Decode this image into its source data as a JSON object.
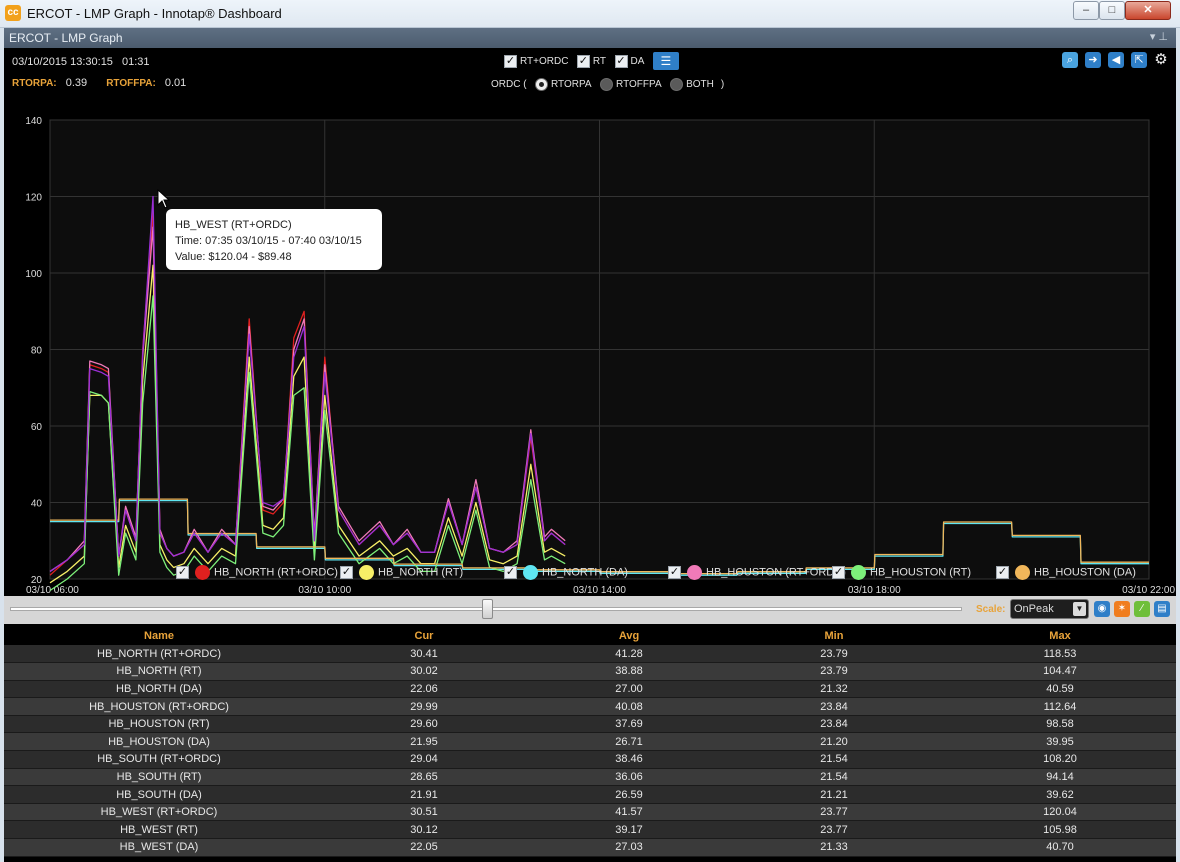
{
  "window": {
    "title": "ERCOT - LMP Graph - Innotap® Dashboard",
    "icon_glyph": "cc",
    "minimize_glyph": "–",
    "maximize_glyph": "□",
    "close_glyph": "✕"
  },
  "panel": {
    "title": "ERCOT - LMP Graph",
    "pin_glyphs": "▾ ⊥"
  },
  "info": {
    "timestamp": "03/10/2015 13:30:15",
    "counter": "01:31",
    "rtorpa_label": "RTORPA:",
    "rtorpa_value": "0.39",
    "rtoffpa_label": "RTOFFPA:",
    "rtoffpa_value": "0.01"
  },
  "controls": {
    "checkbox_glyph": "✓",
    "toggles": [
      "RT+ORDC",
      "RT",
      "DA"
    ],
    "list_icon": "list-icon",
    "ordc_label": "ORDC (",
    "ordc_close": ")",
    "ordc_options": [
      "RTORPA",
      "RTOFFPA",
      "BOTH"
    ],
    "ordc_selected": "RTORPA"
  },
  "toolbar_icons": [
    {
      "name": "zoom-icon",
      "glyph": "⌕",
      "color": "#4aa3df"
    },
    {
      "name": "arrow-right-icon",
      "glyph": "➜",
      "color": "#2f7fc8"
    },
    {
      "name": "speaker-icon",
      "glyph": "◀",
      "color": "#2f7fc8"
    },
    {
      "name": "popout-icon",
      "glyph": "⇱",
      "color": "#2f7fc8"
    },
    {
      "name": "gear-icon",
      "glyph": "⚙",
      "color": "#000000"
    }
  ],
  "tooltip": {
    "title": "HB_WEST (RT+ORDC)",
    "time": "Time: 07:35 03/10/15 - 07:40 03/10/15",
    "value": "Value: $120.04 - $89.48"
  },
  "legend": [
    {
      "label": "HB_NORTH (RT+ORDC)",
      "color": "#e0201f"
    },
    {
      "label": "HB_NORTH (RT)",
      "color": "#f7ef67"
    },
    {
      "label": "HB_NORTH (DA)",
      "color": "#5fe6f2"
    },
    {
      "label": "HB_HOUSTON (RT+ORDC)",
      "color": "#f07ab8"
    },
    {
      "label": "HB_HOUSTON (RT)",
      "color": "#7df07a"
    },
    {
      "label": "HB_HOUSTON (DA)",
      "color": "#f0b65a"
    }
  ],
  "scroller": {
    "position_fraction": 0.5,
    "scale_label": "Scale:",
    "scale_value": "OnPeak",
    "caret_glyph": "▼",
    "buttons": [
      {
        "name": "eye-icon",
        "glyph": "◉",
        "color": "#2f7fc8"
      },
      {
        "name": "swap-icon",
        "glyph": "✶",
        "color": "#f07d1e"
      },
      {
        "name": "pencil-icon",
        "glyph": "∕",
        "color": "#6fbf3a"
      },
      {
        "name": "export-icon",
        "glyph": "▤",
        "color": "#2f7fc8"
      }
    ]
  },
  "table": {
    "headers": [
      "Name",
      "Cur",
      "Avg",
      "Min",
      "Max"
    ],
    "rows": [
      [
        "HB_NORTH (RT+ORDC)",
        "30.41",
        "41.28",
        "23.79",
        "118.53"
      ],
      [
        "HB_NORTH (RT)",
        "30.02",
        "38.88",
        "23.79",
        "104.47"
      ],
      [
        "HB_NORTH (DA)",
        "22.06",
        "27.00",
        "21.32",
        "40.59"
      ],
      [
        "HB_HOUSTON (RT+ORDC)",
        "29.99",
        "40.08",
        "23.84",
        "112.64"
      ],
      [
        "HB_HOUSTON (RT)",
        "29.60",
        "37.69",
        "23.84",
        "98.58"
      ],
      [
        "HB_HOUSTON (DA)",
        "21.95",
        "26.71",
        "21.20",
        "39.95"
      ],
      [
        "HB_SOUTH (RT+ORDC)",
        "29.04",
        "38.46",
        "21.54",
        "108.20"
      ],
      [
        "HB_SOUTH (RT)",
        "28.65",
        "36.06",
        "21.54",
        "94.14"
      ],
      [
        "HB_SOUTH (DA)",
        "21.91",
        "26.59",
        "21.21",
        "39.62"
      ],
      [
        "HB_WEST (RT+ORDC)",
        "30.51",
        "41.57",
        "23.77",
        "120.04"
      ],
      [
        "HB_WEST (RT)",
        "30.12",
        "39.17",
        "23.77",
        "105.98"
      ],
      [
        "HB_WEST (DA)",
        "22.05",
        "27.03",
        "21.33",
        "40.70"
      ]
    ]
  },
  "chart_data": {
    "type": "line",
    "ylim": [
      20,
      140
    ],
    "yticks": [
      "140",
      "120",
      "100",
      "80",
      "60",
      "40",
      "20"
    ],
    "xlim_hours": [
      6,
      22
    ],
    "xticks": [
      "03/10 06:00",
      "03/10 10:00",
      "03/10 14:00",
      "03/10 18:00",
      "03/10 22:00"
    ],
    "grid": true,
    "legend_position": "bottom",
    "series": [
      {
        "name": "HB_NORTH (RT+ORDC)",
        "color": "#e0201f",
        "offset": 0,
        "x": [
          6.0,
          6.25,
          6.5,
          6.58,
          6.75,
          6.85,
          7.0,
          7.1,
          7.25,
          7.35,
          7.5,
          7.6,
          7.7,
          7.8,
          7.95,
          8.1,
          8.3,
          8.5,
          8.7,
          8.9,
          9.1,
          9.25,
          9.4,
          9.55,
          9.7,
          9.85,
          10.0,
          10.2,
          10.5,
          10.8,
          11.0,
          11.2,
          11.4,
          11.6,
          11.8,
          12.0,
          12.2,
          12.4,
          12.6,
          12.8,
          13.0,
          13.2,
          13.3,
          13.5
        ],
        "y": [
          21,
          25,
          29,
          76,
          75,
          74,
          26,
          38,
          30,
          80,
          116,
          32,
          28,
          26,
          27,
          32,
          27,
          32,
          29,
          88,
          38,
          37,
          40,
          83,
          90,
          30,
          78,
          38,
          29,
          34,
          29,
          32,
          27,
          27,
          40,
          29,
          44,
          28,
          27,
          29,
          57,
          30,
          32,
          29
        ]
      },
      {
        "name": "HB_NORTH (RT)",
        "color": "#f7ef67",
        "offset": -2,
        "x": [
          6.0,
          6.25,
          6.5,
          6.58,
          6.75,
          6.85,
          7.0,
          7.1,
          7.25,
          7.35,
          7.5,
          7.6,
          7.7,
          7.8,
          7.95,
          8.1,
          8.3,
          8.5,
          8.7,
          8.9,
          9.1,
          9.25,
          9.4,
          9.55,
          9.7,
          9.85,
          10.0,
          10.2,
          10.5,
          10.8,
          11.0,
          11.2,
          11.4,
          11.6,
          11.8,
          12.0,
          12.2,
          12.4,
          12.6,
          12.8,
          13.0,
          13.2,
          13.3,
          13.5
        ],
        "y": [
          21,
          24,
          28,
          70,
          70,
          68,
          25,
          36,
          29,
          74,
          104,
          31,
          27,
          25,
          26,
          30,
          26,
          30,
          28,
          80,
          36,
          35,
          38,
          75,
          80,
          29,
          70,
          36,
          28,
          32,
          28,
          30,
          26,
          26,
          38,
          28,
          42,
          27,
          26,
          28,
          52,
          29,
          30,
          28
        ]
      },
      {
        "name": "HB_NORTH (DA)",
        "color": "#5fe6f2",
        "offset": 0,
        "x": [
          6.0,
          7.0,
          7.01,
          8.0,
          8.01,
          9.0,
          9.01,
          10.0,
          10.01,
          11.0,
          11.01,
          12.0,
          12.01,
          13.0,
          13.01,
          14.0,
          14.01,
          15.0,
          15.01,
          16.0,
          16.01,
          17.0,
          17.01,
          18.0,
          18.01,
          19.0,
          19.01,
          20.0,
          20.01,
          21.0,
          21.01,
          22.0
        ],
        "y": [
          35,
          35,
          40.5,
          40.5,
          31.5,
          31.5,
          28,
          28,
          25,
          25,
          23.5,
          23.5,
          22.5,
          22.5,
          22,
          22,
          21.5,
          21.5,
          21,
          21,
          21.5,
          21.5,
          22.5,
          22.5,
          26,
          26,
          34.5,
          34.5,
          31,
          31,
          24,
          24
        ]
      },
      {
        "name": "HB_HOUSTON (RT+ORDC)",
        "color": "#f07ab8",
        "offset": 0,
        "x": [
          6.0,
          6.25,
          6.5,
          6.58,
          6.75,
          6.85,
          7.0,
          7.1,
          7.25,
          7.35,
          7.5,
          7.6,
          7.7,
          7.8,
          7.95,
          8.1,
          8.3,
          8.5,
          8.7,
          8.9,
          9.1,
          9.25,
          9.4,
          9.55,
          9.7,
          9.85,
          10.0,
          10.2,
          10.5,
          10.8,
          11.0,
          11.2,
          11.4,
          11.6,
          11.8,
          12.0,
          12.2,
          12.4,
          12.6,
          12.8,
          13.0,
          13.2,
          13.3,
          13.5
        ],
        "y": [
          22,
          25,
          30,
          77,
          76,
          75,
          26,
          39,
          31,
          78,
          112,
          33,
          28,
          26,
          27,
          33,
          27,
          33,
          29,
          86,
          39,
          38,
          41,
          80,
          88,
          31,
          76,
          39,
          30,
          35,
          29,
          33,
          27,
          27,
          41,
          29,
          46,
          28,
          27,
          30,
          59,
          31,
          33,
          30
        ]
      },
      {
        "name": "HB_HOUSTON (RT)",
        "color": "#7df07a",
        "offset": -4,
        "x": [
          6.0,
          6.25,
          6.5,
          6.58,
          6.75,
          6.85,
          7.0,
          7.1,
          7.25,
          7.35,
          7.5,
          7.6,
          7.7,
          7.8,
          7.95,
          8.1,
          8.3,
          8.5,
          8.7,
          8.9,
          9.1,
          9.25,
          9.4,
          9.55,
          9.7,
          9.85,
          10.0,
          10.2,
          10.5,
          10.8,
          11.0,
          11.2,
          11.4,
          11.6,
          11.8,
          12.0,
          12.2,
          12.4,
          12.6,
          12.8,
          13.0,
          13.2,
          13.3,
          13.5
        ],
        "y": [
          21,
          24,
          28,
          73,
          72,
          70,
          25,
          36,
          29,
          70,
          98,
          31,
          27,
          25,
          26,
          30,
          26,
          30,
          28,
          78,
          36,
          35,
          38,
          72,
          74,
          29,
          68,
          36,
          28,
          32,
          28,
          30,
          26,
          26,
          38,
          28,
          42,
          27,
          26,
          28,
          50,
          29,
          30,
          28
        ]
      },
      {
        "name": "HB_HOUSTON (DA)",
        "color": "#f0b65a",
        "offset": 0.4,
        "x": [
          6.0,
          7.0,
          7.01,
          8.0,
          8.01,
          9.0,
          9.01,
          10.0,
          10.01,
          11.0,
          11.01,
          12.0,
          12.01,
          13.0,
          13.01,
          14.0,
          14.01,
          15.0,
          15.01,
          16.0,
          16.01,
          17.0,
          17.01,
          18.0,
          18.01,
          19.0,
          19.01,
          20.0,
          20.01,
          21.0,
          21.01,
          22.0
        ],
        "y": [
          35,
          35,
          40.5,
          40.5,
          31.5,
          31.5,
          28,
          28,
          25,
          25,
          23.5,
          23.5,
          22.5,
          22.5,
          22,
          22,
          21.5,
          21.5,
          21,
          21,
          21.5,
          21.5,
          22.5,
          22.5,
          26,
          26,
          34.5,
          34.5,
          31,
          31,
          24,
          24
        ]
      },
      {
        "name": "HB_WEST (RT+ORDC)",
        "color": "#9b2fd6",
        "offset": 0,
        "x": [
          6.0,
          6.25,
          6.5,
          6.58,
          6.75,
          6.85,
          7.0,
          7.1,
          7.25,
          7.35,
          7.5,
          7.6,
          7.7,
          7.8,
          7.95,
          8.1,
          8.3,
          8.5,
          8.7,
          8.9,
          9.1,
          9.25,
          9.4,
          9.55,
          9.7,
          9.85,
          10.0,
          10.2,
          10.5,
          10.8,
          11.0,
          11.2,
          11.4,
          11.6,
          11.8,
          12.0,
          12.2,
          12.4,
          12.6,
          12.8,
          13.0,
          13.2,
          13.3,
          13.5
        ],
        "y": [
          22,
          25,
          29,
          75,
          74,
          73,
          26,
          38,
          30,
          79,
          120,
          32,
          28,
          26,
          27,
          32,
          27,
          32,
          29,
          84,
          40,
          39,
          41,
          78,
          86,
          30,
          74,
          38,
          29,
          34,
          29,
          32,
          27,
          27,
          40,
          29,
          44,
          28,
          27,
          29,
          58,
          30,
          32,
          29
        ]
      }
    ]
  }
}
